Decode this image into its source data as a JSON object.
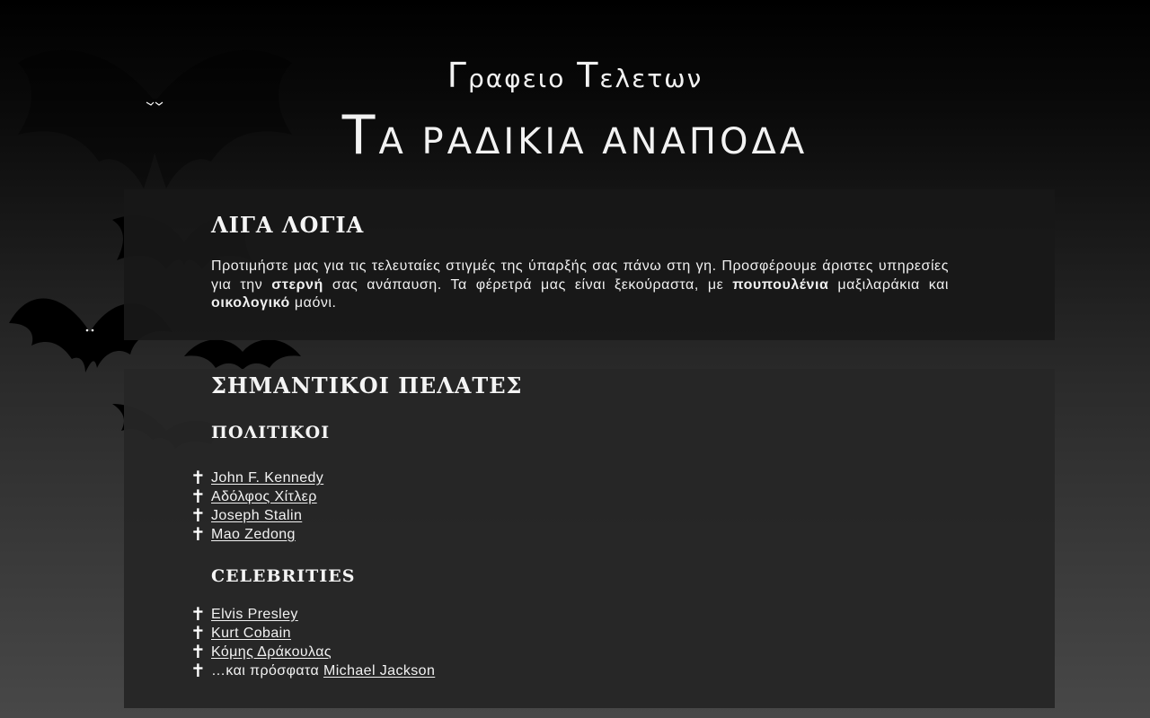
{
  "header": {
    "office_first": "Γ",
    "office_rest": "ραφειο",
    "office_second_first": "Τ",
    "office_second_rest": "ελετων",
    "name_first": "Τ",
    "name_rest": "α ραδικια αναποδα"
  },
  "about": {
    "title": "ΛΙΓΑ ΛΟΓΙΑ",
    "text_1": "Προτιμήστε μας για τις τελευταίες στιγμές της ύπαρξής σας πάνω στη γη. Προσφέρουμε άριστες υπηρεσίες για την ",
    "bold_1": "στερνή",
    "text_2": " σας ανάπαυση. Τα φέρετρά μας είναι ξεκούραστα, με ",
    "bold_2": "πουπουλένια",
    "text_3": " μαξιλαράκια και ",
    "bold_3": "οικολογικό",
    "text_4": " μαόνι."
  },
  "clients": {
    "title": "ΣΗΜΑΝΤΙΚΟΙ ΠΕΛΑΤΕΣ",
    "bullet": "✝",
    "politicians": {
      "title": "ΠΟΛΙΤΙΚΟΙ",
      "items": [
        "John F. Kennedy",
        "Αδόλφος Χίτλερ",
        "Joseph Stalin",
        "Mao Zedong"
      ]
    },
    "celebrities": {
      "title": "CELEBRITIES",
      "items": [
        "Elvis Presley",
        "Kurt Cobain",
        "Κόμης Δράκουλας"
      ],
      "last_prefix": "…και πρόσφατα ",
      "last_link": "Michael Jackson"
    }
  },
  "decor": {
    "bat_color": "#000000",
    "bat_eye_color": "#ffffff",
    "bat_count": 6
  }
}
